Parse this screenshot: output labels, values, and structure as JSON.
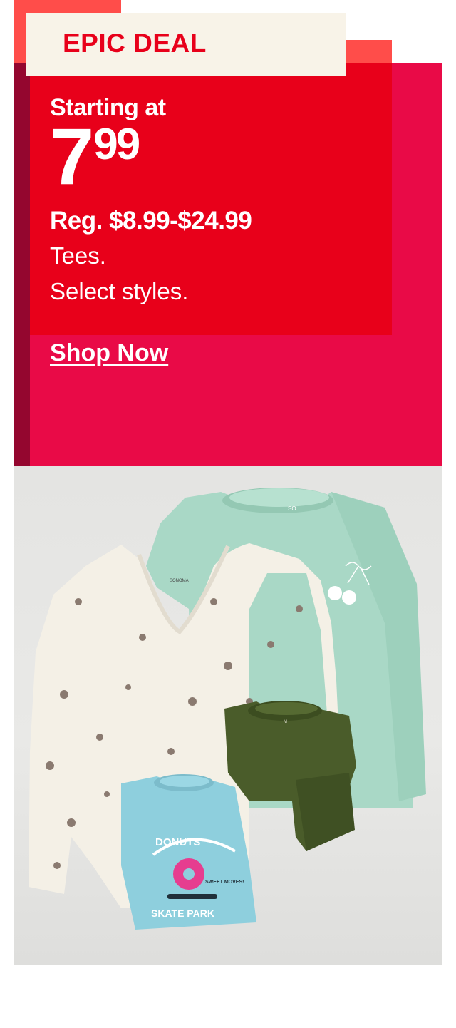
{
  "promo": {
    "tag": "EPIC DEAL",
    "starting_at": "Starting at",
    "price_dollars": "7",
    "price_cents": "99",
    "regular_price": "Reg. $8.99-$24.99",
    "description_line1": "Tees.",
    "description_line2": "Select styles.",
    "cta": "Shop Now"
  },
  "colors": {
    "accent_red": "#e8001a",
    "accent_pink": "#e90a47",
    "accent_maroon": "#94062f",
    "accent_coral": "#ff4d4a",
    "tag_background": "#f8f3e8",
    "text_white": "#ffffff"
  },
  "product_image": {
    "shirt_tags": [
      "SONOMA",
      "SO",
      "M"
    ],
    "graphic_text_1": "DONUTS",
    "graphic_text_2": "SWEET MOVES!",
    "graphic_text_3": "SKATE PARK"
  }
}
